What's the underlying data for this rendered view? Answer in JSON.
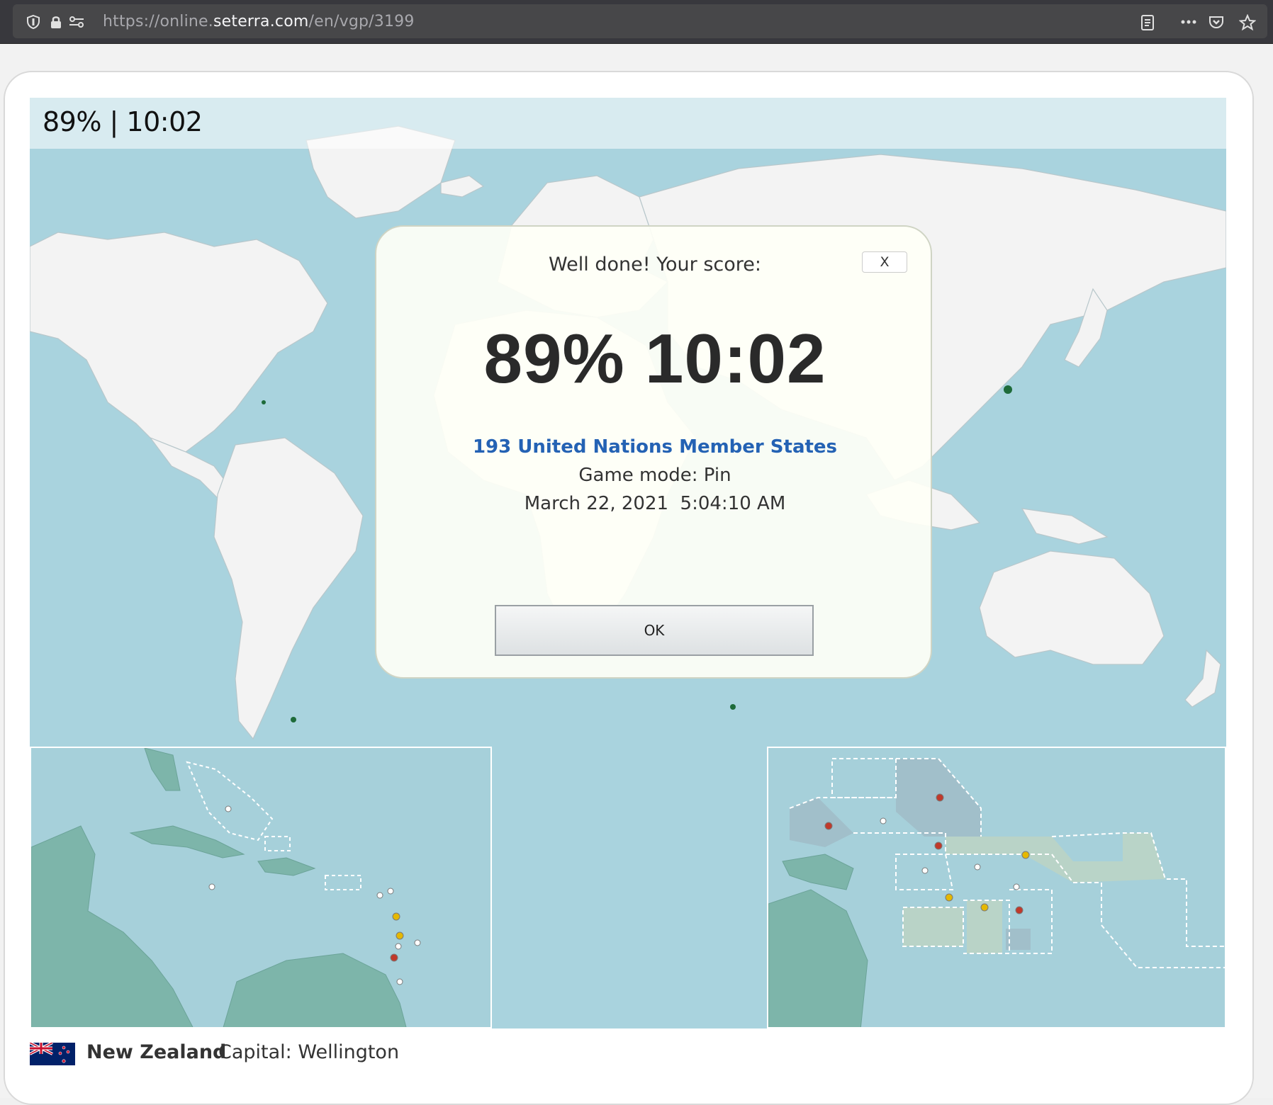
{
  "browser": {
    "url_prefix": "https://online.",
    "url_domain": "seterra.com",
    "url_path": "/en/vgp/3199",
    "icons": [
      "shield-icon",
      "lock-icon",
      "permissions-icon",
      "reader-view-icon",
      "more-icon",
      "pocket-icon",
      "bookmark-star-icon"
    ]
  },
  "game": {
    "score_overlay": "89% | 10:02"
  },
  "modal": {
    "title": "Well done! Your score:",
    "close_label": "X",
    "big_score": "89% 10:02",
    "quiz_name": "193 United Nations Member States",
    "game_mode": "Game mode: Pin",
    "date": "March 22, 2021  5:04:10 AM",
    "ok_label": "OK"
  },
  "footer": {
    "country": "New Zealand",
    "capital": "Capital: Wellington",
    "flag_icon": "new-zealand-flag-icon"
  },
  "colors": {
    "ocean": "#a9d3de",
    "land": "#f2f2f2",
    "inset_land": "#7db5aa",
    "link": "#2462b4",
    "pin_red": "#c0392b",
    "pin_yellow": "#e5b800",
    "pin_white": "#ffffff"
  }
}
